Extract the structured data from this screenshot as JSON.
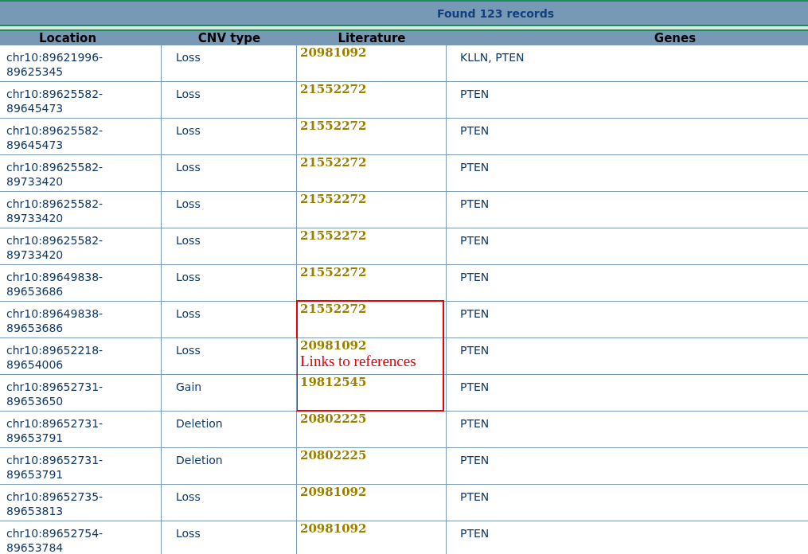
{
  "title": "Found 123 records",
  "columns": [
    "Location",
    "CNV type",
    "Literature",
    "Genes"
  ],
  "rows": [
    {
      "location": "chr10:89621996-89625345",
      "cnv_type": "Loss",
      "literature": "20981092",
      "genes": "KLLN, PTEN",
      "in_callout": false
    },
    {
      "location": "chr10:89625582-89645473",
      "cnv_type": "Loss",
      "literature": "21552272",
      "genes": "PTEN",
      "in_callout": false
    },
    {
      "location": "chr10:89625582-89645473",
      "cnv_type": "Loss",
      "literature": "21552272",
      "genes": "PTEN",
      "in_callout": false
    },
    {
      "location": "chr10:89625582-89733420",
      "cnv_type": "Loss",
      "literature": "21552272",
      "genes": "PTEN",
      "in_callout": false
    },
    {
      "location": "chr10:89625582-89733420",
      "cnv_type": "Loss",
      "literature": "21552272",
      "genes": "PTEN",
      "in_callout": false
    },
    {
      "location": "chr10:89625582-89733420",
      "cnv_type": "Loss",
      "literature": "21552272",
      "genes": "PTEN",
      "in_callout": false
    },
    {
      "location": "chr10:89649838-89653686",
      "cnv_type": "Loss",
      "literature": "21552272",
      "genes": "PTEN",
      "in_callout": false
    },
    {
      "location": "chr10:89649838-89653686",
      "cnv_type": "Loss",
      "literature": "21552272",
      "genes": "PTEN",
      "in_callout": true
    },
    {
      "location": "chr10:89652218-89654006",
      "cnv_type": "Loss",
      "literature": "20981092",
      "genes": "PTEN",
      "in_callout": true
    },
    {
      "location": "chr10:89652731-89653650",
      "cnv_type": "Gain",
      "literature": "19812545",
      "genes": "PTEN",
      "in_callout": true
    },
    {
      "location": "chr10:89652731-89653791",
      "cnv_type": "Deletion",
      "literature": "20802225",
      "genes": "PTEN",
      "in_callout": false
    },
    {
      "location": "chr10:89652731-89653791",
      "cnv_type": "Deletion",
      "literature": "20802225",
      "genes": "PTEN",
      "in_callout": false
    },
    {
      "location": "chr10:89652735-89653813",
      "cnv_type": "Loss",
      "literature": "20981092",
      "genes": "PTEN",
      "in_callout": false
    },
    {
      "location": "chr10:89652754-89653784",
      "cnv_type": "Loss",
      "literature": "20981092",
      "genes": "PTEN",
      "in_callout": false
    }
  ],
  "callout": {
    "text": "Links to references"
  }
}
